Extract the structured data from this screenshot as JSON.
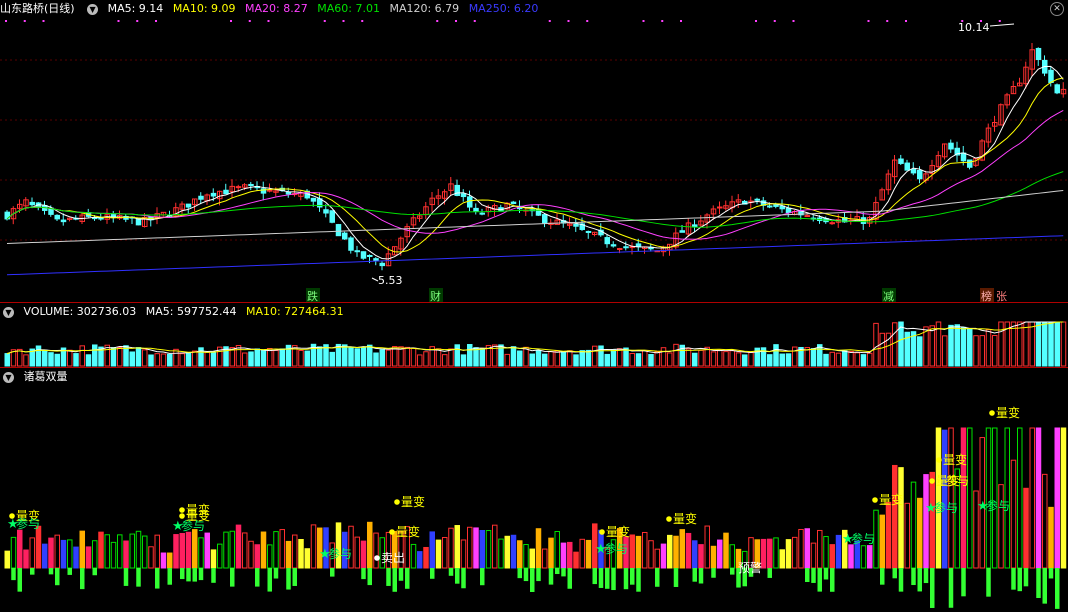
{
  "price_header": {
    "stock_name": "山东路桥",
    "period": "(日线)",
    "ma5": "MA5: 9.14",
    "ma10": "MA10: 9.09",
    "ma20": "MA20: 8.27",
    "ma60": "MA60: 7.01",
    "ma120": "MA120: 6.79",
    "ma250": "MA250: 6.20"
  },
  "price_labels": {
    "high_price": "10.14",
    "low_price": "5.53"
  },
  "events": [
    "跌",
    "财",
    "减",
    "榜",
    "张"
  ],
  "volume_header": {
    "volume": "VOLUME: 302736.03",
    "ma5": "MA5: 597752.44",
    "ma10": "MA10: 727464.31"
  },
  "indicator_header": {
    "name": "诸葛双量"
  },
  "signals": {
    "liang_bian": "量变",
    "can_yu": "参与",
    "mai_chu": "卖出",
    "yu_jing": "预警"
  },
  "colors": {
    "background": "#000000",
    "up": "#ff3030",
    "down": "#54ffff",
    "ma5": "#ffffff",
    "ma10": "#ffff00",
    "ma20": "#ff40ff",
    "ma60": "#00e000",
    "ma120": "#d0d0d0",
    "ma250": "#3030ff",
    "signal_yellow": "#ffff00",
    "signal_green": "#00ff66",
    "divider": "#b00000"
  }
}
